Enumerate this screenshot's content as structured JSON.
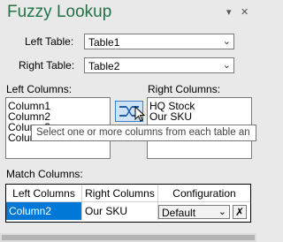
{
  "pane": {
    "title": "Fuzzy Lookup",
    "menu_glyph": "▾",
    "close_glyph": "✕"
  },
  "tables": {
    "left_label": "Left Table:",
    "left_value": "Table1",
    "right_label": "Right Table:",
    "right_value": "Table2"
  },
  "columns": {
    "left_label": "Left Columns:",
    "left_items": [
      "Column1",
      "Column2",
      "Column3",
      "Column4"
    ],
    "right_label": "Right Columns:",
    "right_items": [
      "HQ Stock",
      "Our SKU"
    ]
  },
  "tooltip": "Select one or more columns from each table an",
  "match": {
    "label": "Match Columns:",
    "headers": [
      "Left Columns",
      "Right Columns",
      "Configuration"
    ],
    "row": {
      "left": "Column2",
      "right": "Our SKU",
      "configuration": "Default"
    }
  },
  "icons": {
    "dropdown": "chevron-down-icon",
    "match": "match-columns-icon",
    "delete": "delete-row-icon"
  },
  "colors": {
    "title": "#217346",
    "selection": "#0078d7",
    "match_button_bg": "#cfe3f7"
  }
}
